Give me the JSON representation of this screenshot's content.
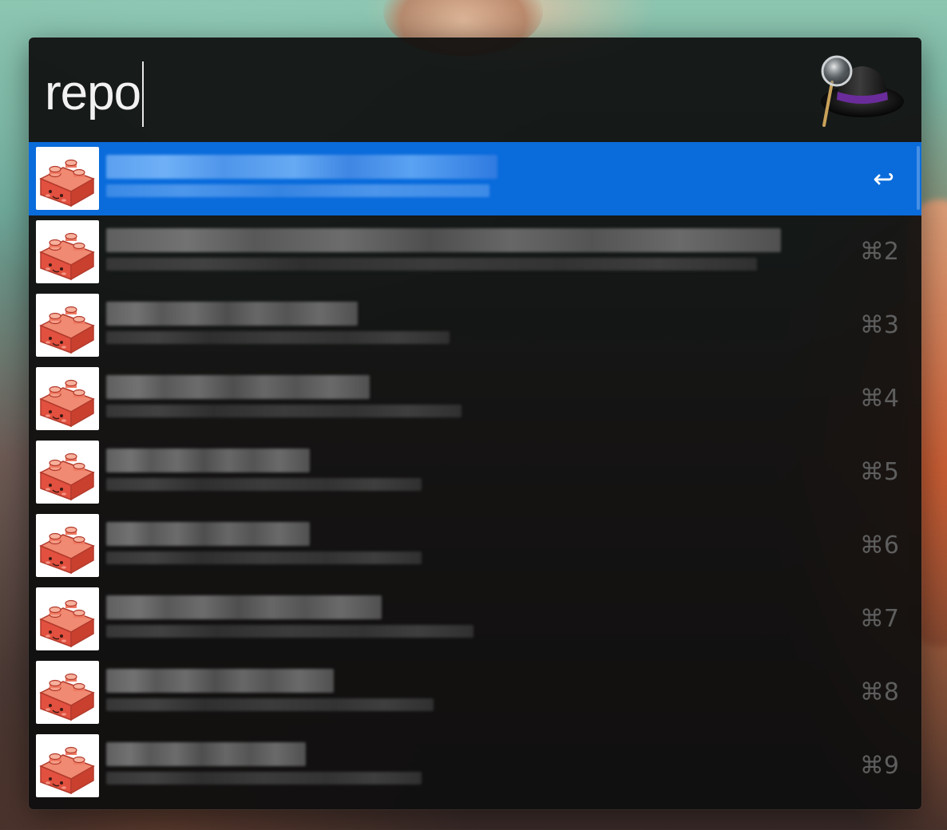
{
  "search": {
    "query": "repo"
  },
  "logo": {
    "icon": "alfred-hat-icon"
  },
  "results": [
    {
      "index": 1,
      "selected": true,
      "shortcut": "↩",
      "icon": "lego-block-icon",
      "title_obscured": true,
      "subtitle_obscured": true
    },
    {
      "index": 2,
      "selected": false,
      "shortcut": "⌘2",
      "icon": "lego-block-icon",
      "title_obscured": true,
      "subtitle_obscured": true
    },
    {
      "index": 3,
      "selected": false,
      "shortcut": "⌘3",
      "icon": "lego-block-icon",
      "title_obscured": true,
      "subtitle_obscured": true
    },
    {
      "index": 4,
      "selected": false,
      "shortcut": "⌘4",
      "icon": "lego-block-icon",
      "title_obscured": true,
      "subtitle_obscured": true
    },
    {
      "index": 5,
      "selected": false,
      "shortcut": "⌘5",
      "icon": "lego-block-icon",
      "title_obscured": true,
      "subtitle_obscured": true
    },
    {
      "index": 6,
      "selected": false,
      "shortcut": "⌘6",
      "icon": "lego-block-icon",
      "title_obscured": true,
      "subtitle_obscured": true
    },
    {
      "index": 7,
      "selected": false,
      "shortcut": "⌘7",
      "icon": "lego-block-icon",
      "title_obscured": true,
      "subtitle_obscured": true
    },
    {
      "index": 8,
      "selected": false,
      "shortcut": "⌘8",
      "icon": "lego-block-icon",
      "title_obscured": true,
      "subtitle_obscured": true
    },
    {
      "index": 9,
      "selected": false,
      "shortcut": "⌘9",
      "icon": "lego-block-icon",
      "title_obscured": true,
      "subtitle_obscured": true
    }
  ],
  "colors": {
    "selection": "#0a6bdb",
    "panel": "#0e0e0e",
    "shortcut_text": "#5e5e5e",
    "icon_brick": "#e85a4a"
  }
}
